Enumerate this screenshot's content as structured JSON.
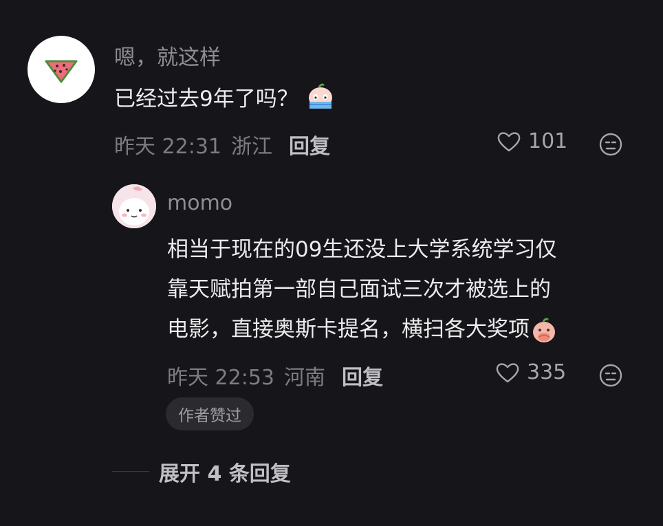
{
  "comment": {
    "username": "嗯，就这样",
    "text": "已经过去9年了吗？",
    "time": "昨天 22:31",
    "location": "浙江",
    "reply_label": "回复",
    "likes": "101",
    "avatar_icon": "watermelon-icon",
    "emoji_icon": "crying-emoji-icon"
  },
  "reply": {
    "username": "momo",
    "lines": [
      "相当于现在的09生还没上大学系统学习仅",
      "靠天赋拍第一部自己面试三次才被选上的",
      "电影，直接奥斯卡提名，横扫各大奖项"
    ],
    "time": "昨天 22:53",
    "location": "河南",
    "reply_label": "回复",
    "likes": "335",
    "badge": "作者赞过",
    "avatar_icon": "pink-bunny-avatar",
    "emoji_icon": "covering-mouth-emoji-icon"
  },
  "expand": {
    "label": "展开 4 条回复"
  },
  "colors": {
    "background": "#16161a",
    "primary_text": "#ececee",
    "secondary_text": "#8e8e93",
    "badge_bg": "#2a2a2f"
  }
}
